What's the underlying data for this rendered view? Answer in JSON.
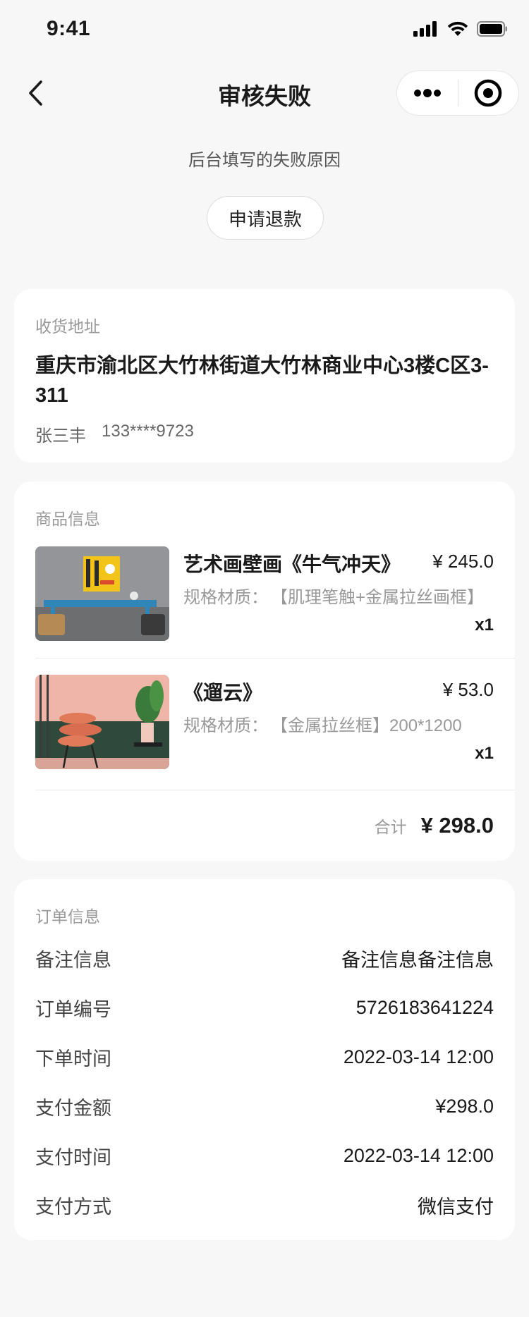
{
  "status_bar": {
    "time": "9:41"
  },
  "nav": {
    "title": "审核失败"
  },
  "failure": {
    "reason": "后台填写的失败原因",
    "refund_label": "申请退款"
  },
  "address": {
    "section_title": "收货地址",
    "text": "重庆市渝北区大竹林街道大竹林商业中心3楼C区3-311",
    "name": "张三丰",
    "phone": "133****9723"
  },
  "goods": {
    "section_title": "商品信息",
    "items": [
      {
        "name": "艺术画壁画《牛气冲天》",
        "price": "¥ 245.0",
        "spec_label": "规格材质：",
        "spec_value": "【肌理笔触+金属拉丝画框】",
        "qty": "x1",
        "image": "artwork-yellow-painting-thumbnail"
      },
      {
        "name": "《遛云》",
        "price": "¥ 53.0",
        "spec_label": "规格材质：",
        "spec_value": "【金属拉丝框】200*1200",
        "qty": "x1",
        "image": "pink-room-chair-thumbnail"
      }
    ],
    "total_label": "合计",
    "total_value": "¥ 298.0"
  },
  "order": {
    "section_title": "订单信息",
    "rows": [
      {
        "key": "备注信息",
        "value": "备注信息备注信息"
      },
      {
        "key": "订单编号",
        "value": "5726183641224"
      },
      {
        "key": "下单时间",
        "value": "2022-03-14 12:00"
      },
      {
        "key": "支付金额",
        "value": "¥298.0"
      },
      {
        "key": "支付时间",
        "value": "2022-03-14 12:00"
      },
      {
        "key": "支付方式",
        "value": "微信支付"
      }
    ]
  }
}
